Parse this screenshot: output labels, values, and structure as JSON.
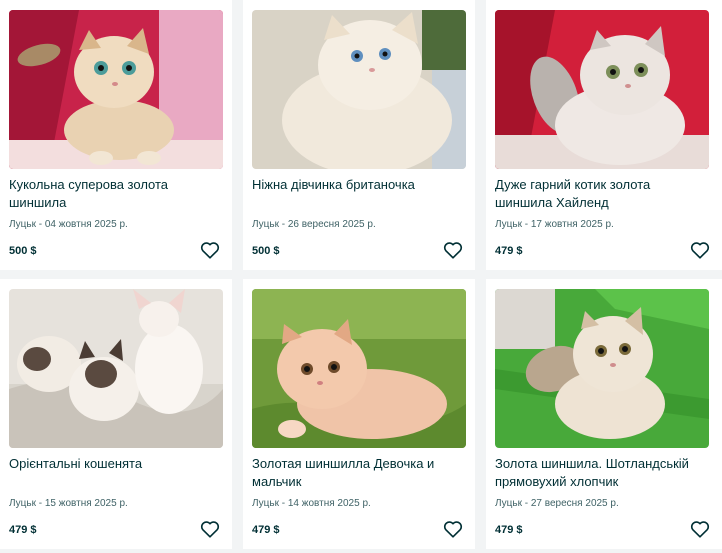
{
  "listings": [
    {
      "title": "Кукольна суперова золота шиншила",
      "meta": "Луцьк - 04 жовтня 2025 р.",
      "price": "500 $",
      "image": "golden-chinchilla-kitten-on-pink-background"
    },
    {
      "title": "Ніжна дівчинка британочка",
      "meta": "Луцьк - 26 вересня 2025 р.",
      "price": "500 $",
      "image": "fluffy-cream-kitten-blue-eyes"
    },
    {
      "title": "Дуже гарний котик золота шиншила Хайленд",
      "meta": "Луцьк - 17 жовтня 2025 р.",
      "price": "479 $",
      "image": "silver-longhair-kitten-red-background"
    },
    {
      "title": "Орієнтальні кошенята",
      "meta": "Луцьк - 15 жовтня 2025 р.",
      "price": "479 $",
      "image": "oriental-siamese-kittens-on-blanket"
    },
    {
      "title": "Золотая шиншилла Девочка и мальчик",
      "meta": "Луцьк - 14 жовтня 2025 р.",
      "price": "479 $",
      "image": "peach-kitten-on-green-rug"
    },
    {
      "title": "Золота шиншила. Шотландській прямовухий хлопчик",
      "meta": "Луцьк - 27 вересня 2025 р.",
      "price": "479 $",
      "image": "longhair-golden-kitten-on-green-stripes"
    }
  ],
  "icons": {
    "favorite": "heart-outline-icon"
  },
  "colors": {
    "text": "#002f34",
    "meta": "#406367",
    "background": "#f2f4f5",
    "card": "#ffffff"
  }
}
